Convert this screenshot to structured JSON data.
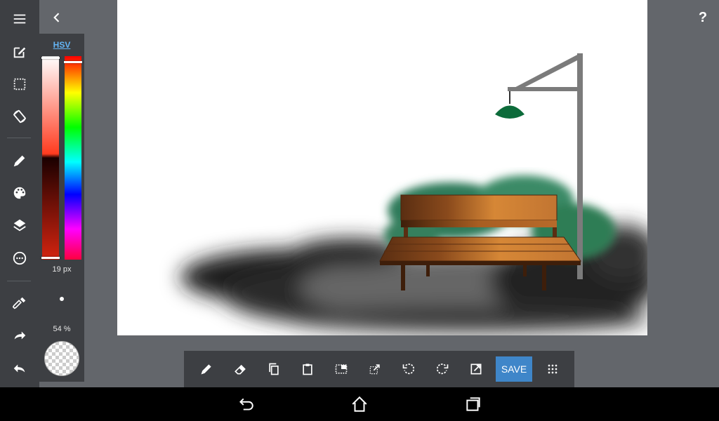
{
  "sidebar": {
    "tools": [
      {
        "icon": "menu-icon"
      },
      {
        "icon": "edit-square-icon"
      },
      {
        "icon": "selection-icon"
      },
      {
        "icon": "rotate-canvas-icon"
      },
      {
        "icon": "pencil-icon"
      },
      {
        "icon": "palette-icon"
      },
      {
        "icon": "layers-icon"
      },
      {
        "icon": "more-circle-icon"
      },
      {
        "icon": "eyedropper-icon"
      },
      {
        "icon": "redo-icon"
      },
      {
        "icon": "undo-icon"
      }
    ]
  },
  "color_panel": {
    "mode_label": "HSV",
    "saturation_level": 0.48,
    "hue_level": 0.03,
    "brush_size": "19 px",
    "opacity": "54 %"
  },
  "help": {
    "label": "?"
  },
  "toolbar": {
    "icons": [
      "pen-icon",
      "eraser-icon",
      "copy-icon",
      "paste-icon",
      "select-rect-icon",
      "transform-icon",
      "rotate-left-icon",
      "rotate-right-icon",
      "export-icon",
      "grid-menu-icon"
    ],
    "save_label": "SAVE"
  },
  "navbar": {
    "icons": [
      "back-icon",
      "home-icon",
      "recent-apps-icon"
    ]
  },
  "colors": {
    "accent": "#3f86c9",
    "panel": "#3d3f43",
    "background": "#63666b"
  }
}
